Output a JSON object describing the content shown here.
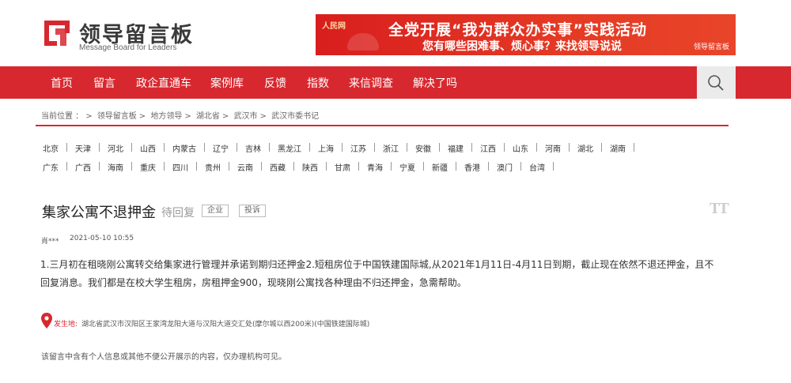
{
  "header": {
    "logo_title": "领导留言板",
    "logo_subtitle": "Message Board for Leaders",
    "banner": {
      "brand": "人民网",
      "line1": "全党开展“我为群众办实事”实践活动",
      "line2": "您有哪些困难事、烦心事？来找领导说说",
      "tag": "领导留言板"
    }
  },
  "nav": {
    "items": [
      "首页",
      "留言",
      "政企直通车",
      "案例库",
      "反馈",
      "指数",
      "来信调查",
      "解决了吗"
    ],
    "search_icon": "search-icon"
  },
  "breadcrumb": {
    "prefix": "当前位置 ：",
    "items": [
      "领导留言板",
      "地方领导",
      "湖北省",
      "武汉市",
      "武汉市委书记"
    ],
    "separator": ">"
  },
  "regions": {
    "row1": [
      "北京",
      "天津",
      "河北",
      "山西",
      "内蒙古",
      "辽宁",
      "吉林",
      "黑龙江",
      "上海",
      "江苏",
      "浙江",
      "安徽",
      "福建",
      "江西",
      "山东",
      "河南",
      "湖北",
      "湖南"
    ],
    "row2": [
      "广东",
      "广西",
      "海南",
      "重庆",
      "四川",
      "贵州",
      "云南",
      "西藏",
      "陕西",
      "甘肃",
      "青海",
      "宁夏",
      "新疆",
      "香港",
      "澳门",
      "台湾"
    ]
  },
  "post": {
    "title": "集家公寓不退押金",
    "status": "待回复",
    "type_tag": "企业",
    "complain_label": "投诉",
    "font_toggle": "TT",
    "author": "肖***",
    "date": "2021-05-10 10:55",
    "body": "1.三月初在租晓刚公寓转交给集家进行管理并承诺到期归还押金2.短租房位于中国铁建国际城,从2021年1月11日-4月11日到期，截止现在依然不退还押金，且不回复消息。我们都是在校大学生租房，房租押金900，现晓刚公寓找各种理由不归还押金，急需帮助。",
    "location_label": "发生地:",
    "location": "湖北省武汉市汉阳区王家湾龙阳大道与汉阳大道交汇处(摩尔城以西200米)(中国铁建国际城)",
    "privacy_note": "该留言中含有个人信息或其他不便公开展示的内容，仅办理机构可见。"
  },
  "colors": {
    "brand_red": "#d8282f",
    "text_dark": "#333333",
    "muted": "#999999"
  }
}
